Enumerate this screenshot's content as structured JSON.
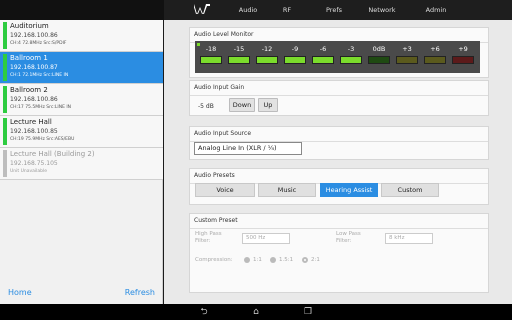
{
  "tabs": [
    {
      "label": "Audio",
      "active": true
    },
    {
      "label": "RF",
      "active": false
    },
    {
      "label": "Prefs",
      "active": false
    },
    {
      "label": "Network",
      "active": false
    },
    {
      "label": "Admin",
      "active": false
    }
  ],
  "units": [
    {
      "name": "Auditorium",
      "ip": "192.168.100.86",
      "info": "CH:4  72.8MHz  Src:S/PDIF",
      "state": "normal"
    },
    {
      "name": "Ballroom 1",
      "ip": "192.168.100.87",
      "info": "CH:1  72.1MHz  Src:LINE IN",
      "state": "selected"
    },
    {
      "name": "Ballroom 2",
      "ip": "192.168.100.86",
      "info": "CH:17  75.5MHz  Src:LINE IN",
      "state": "normal"
    },
    {
      "name": "Lecture Hall",
      "ip": "192.168.100.85",
      "info": "CH:19  75.9MHz  Src:AES/EBU",
      "state": "normal"
    },
    {
      "name": "Lecture Hall (Building 2)",
      "ip": "192.168.75.105",
      "info": "Unit Unavailable",
      "state": "unavailable"
    }
  ],
  "footer": {
    "home": "Home",
    "refresh": "Refresh"
  },
  "level_monitor": {
    "title": "Audio Level Monitor",
    "segments": [
      {
        "label": "-18",
        "lit": true,
        "color": "green"
      },
      {
        "label": "-15",
        "lit": true,
        "color": "green"
      },
      {
        "label": "-12",
        "lit": true,
        "color": "green"
      },
      {
        "label": "-9",
        "lit": true,
        "color": "green"
      },
      {
        "label": "-6",
        "lit": true,
        "color": "green"
      },
      {
        "label": "-3",
        "lit": true,
        "color": "green"
      },
      {
        "label": "0dB",
        "lit": false,
        "color": "green"
      },
      {
        "label": "+3",
        "lit": false,
        "color": "yellow"
      },
      {
        "label": "+6",
        "lit": false,
        "color": "yellow"
      },
      {
        "label": "+9",
        "lit": false,
        "color": "red"
      }
    ]
  },
  "input_gain": {
    "title": "Audio Input Gain",
    "value": "-5 dB",
    "down": "Down",
    "up": "Up"
  },
  "input_source": {
    "title": "Audio Input Source",
    "value": "Analog Line In (XLR / ¼)"
  },
  "presets": {
    "title": "Audio Presets",
    "items": [
      {
        "label": "Voice",
        "active": false
      },
      {
        "label": "Music",
        "active": false
      },
      {
        "label": "Hearing Assist",
        "active": true
      },
      {
        "label": "Custom",
        "active": false
      }
    ]
  },
  "custom_preset": {
    "title": "Custom Preset",
    "high_pass_label": "High Pass Filter:",
    "high_pass_value": "500 Hz",
    "low_pass_label": "Low Pass Filter:",
    "low_pass_value": "8 kHz",
    "compression_label": "Compression:",
    "ratios": [
      {
        "label": "1:1",
        "checked": false
      },
      {
        "label": "1.5:1",
        "checked": false
      },
      {
        "label": "2:1",
        "checked": true
      }
    ]
  },
  "colors": {
    "accent": "#2b8de2",
    "meter_on": "#7bdc2c",
    "status_green": "#2ecc40"
  }
}
